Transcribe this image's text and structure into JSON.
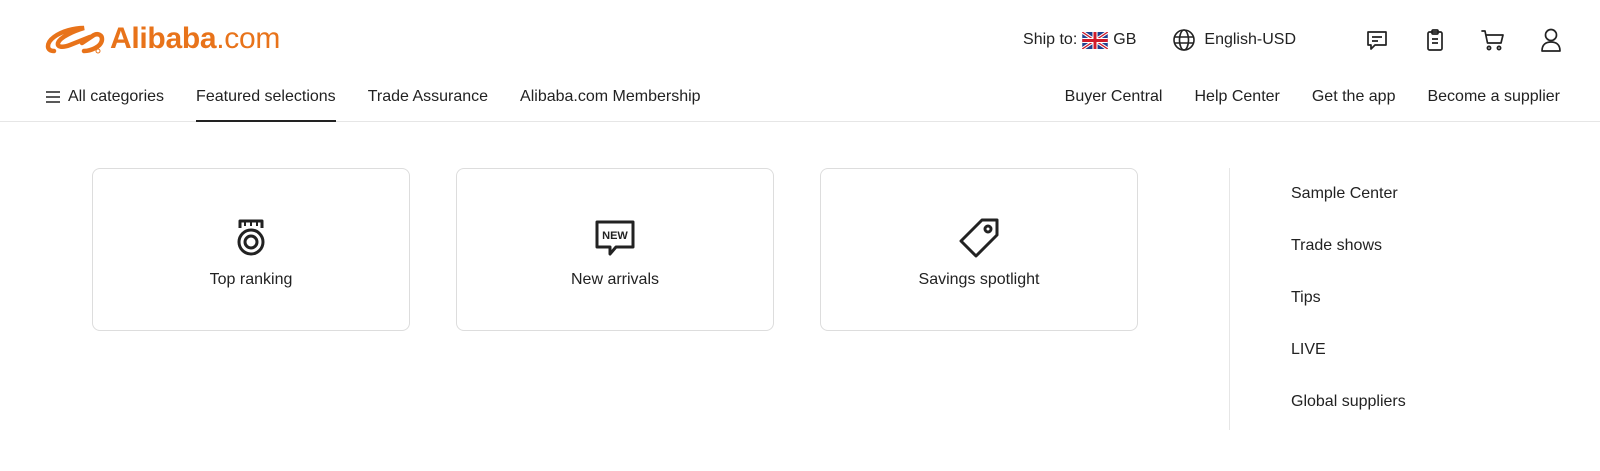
{
  "brand": {
    "name_bold": "Alibaba",
    "name_suffix": ".com",
    "color": "#e8731a"
  },
  "header": {
    "ship_label": "Ship to:",
    "ship_country": "GB",
    "language": "English-USD",
    "icons": [
      "message-icon",
      "orders-icon",
      "cart-icon",
      "account-icon"
    ]
  },
  "nav": {
    "all_categories": "All categories",
    "left_items": [
      "Featured selections",
      "Trade Assurance",
      "Alibaba.com Membership"
    ],
    "active_item": "Featured selections",
    "right_items": [
      "Buyer Central",
      "Help Center",
      "Get the app",
      "Become a supplier"
    ]
  },
  "featured": {
    "cards": [
      {
        "label": "Top ranking",
        "icon": "medal-icon"
      },
      {
        "label": "New arrivals",
        "icon": "new-badge-icon",
        "badge_text": "NEW"
      },
      {
        "label": "Savings spotlight",
        "icon": "price-tag-icon"
      }
    ],
    "side_links": [
      "Sample Center",
      "Trade shows",
      "Tips",
      "LIVE",
      "Global suppliers"
    ]
  }
}
